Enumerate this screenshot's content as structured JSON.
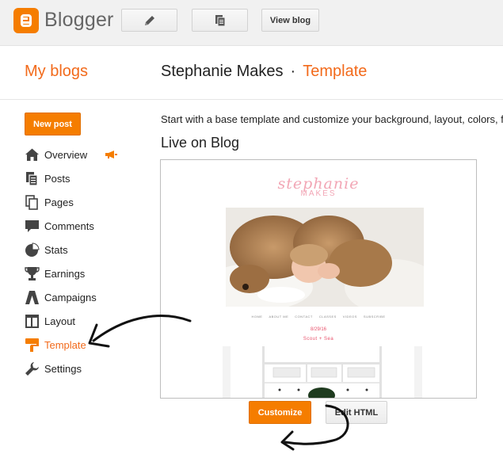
{
  "app": {
    "name": "Blogger",
    "logo_color": "#f57d00"
  },
  "toolbar": {
    "view_blog_label": "View blog",
    "icons": [
      "pencil-icon",
      "copy-icon"
    ]
  },
  "header": {
    "my_blogs": "My blogs",
    "blog_name": "Stephanie Makes",
    "separator": "·",
    "section": "Template"
  },
  "sidebar": {
    "new_post_label": "New post",
    "items": [
      {
        "label": "Overview",
        "icon": "home-icon"
      },
      {
        "label": "Posts",
        "icon": "posts-icon"
      },
      {
        "label": "Pages",
        "icon": "pages-icon"
      },
      {
        "label": "Comments",
        "icon": "comment-icon"
      },
      {
        "label": "Stats",
        "icon": "pie-chart-icon"
      },
      {
        "label": "Earnings",
        "icon": "trophy-icon"
      },
      {
        "label": "Campaigns",
        "icon": "campaigns-icon"
      },
      {
        "label": "Layout",
        "icon": "layout-icon"
      },
      {
        "label": "Template",
        "icon": "template-icon",
        "active": true
      },
      {
        "label": "Settings",
        "icon": "wrench-icon"
      }
    ]
  },
  "main": {
    "intro": "Start with a base template and customize your background, layout, colors, f",
    "live_heading": "Live on Blog",
    "preview": {
      "script_title": "stephanie",
      "subtitle": "MAKES",
      "nav": [
        "HOME",
        "ABOUT ME",
        "CONTACT",
        "CLASSES",
        "VIDEOS",
        "SUBSCRIBE"
      ],
      "date": "8/29/16",
      "post_title": "Scout + Sea"
    },
    "customize_label": "Customize",
    "edit_html_label": "Edit HTML"
  },
  "colors": {
    "accent": "#f26a1b",
    "button_orange": "#f57d00",
    "active_nav": "#f26a1b"
  }
}
